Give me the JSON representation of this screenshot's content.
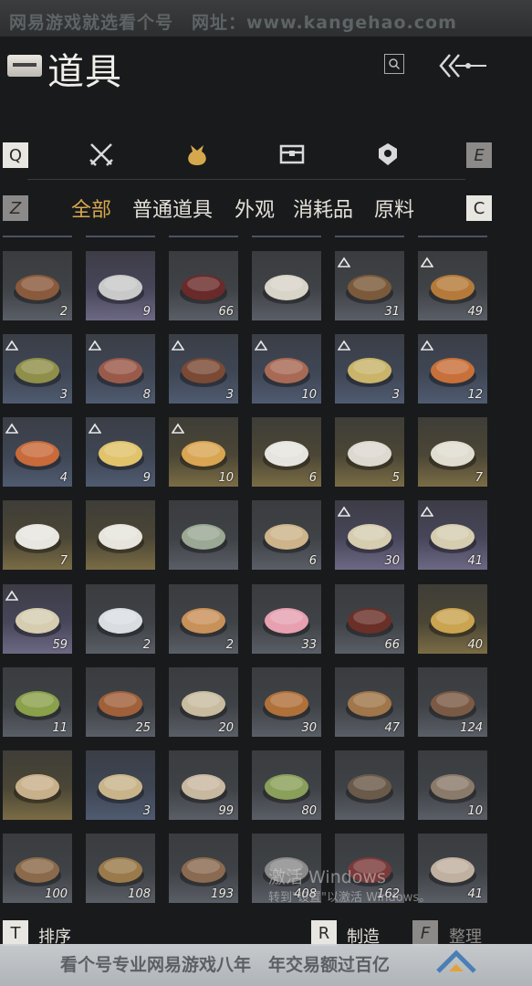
{
  "watermark_top": "网易游戏就选看个号　网址：www.kangehao.com",
  "header": {
    "title": "道具"
  },
  "tabs": {
    "prev_key": "Q",
    "next_key": "E",
    "icons": [
      "weapon-icon",
      "pouch-icon",
      "chest-icon",
      "badge-icon"
    ],
    "active_index": 1
  },
  "subtabs": {
    "prev_key": "Z",
    "next_key": "C",
    "items": [
      "全部",
      "普通道具",
      "外观",
      "消耗品",
      "原料"
    ],
    "active_index": 0
  },
  "items": [
    {
      "name": "stew-bowl",
      "count": "2",
      "tier": "grey",
      "mark": false
    },
    {
      "name": "mountain-emblem",
      "count": "9",
      "tier": "purple",
      "mark": false
    },
    {
      "name": "red-scroll-card",
      "count": "66",
      "tier": "grey",
      "mark": false
    },
    {
      "name": "dumplings",
      "count": "",
      "tier": "grey",
      "mark": false
    },
    {
      "name": "meat-pot",
      "count": "31",
      "tier": "grey",
      "mark": true
    },
    {
      "name": "fried-buns",
      "count": "49",
      "tier": "grey",
      "mark": true
    },
    {
      "name": "herb-dish",
      "count": "3",
      "tier": "blue",
      "mark": true
    },
    {
      "name": "flower-salad",
      "count": "8",
      "tier": "blue",
      "mark": true
    },
    {
      "name": "clay-soup",
      "count": "3",
      "tier": "blue",
      "mark": true
    },
    {
      "name": "braised-pork",
      "count": "10",
      "tier": "blue",
      "mark": true
    },
    {
      "name": "custard-bowl",
      "count": "3",
      "tier": "blue",
      "mark": true
    },
    {
      "name": "meatballs",
      "count": "12",
      "tier": "blue",
      "mark": true
    },
    {
      "name": "fried-chicken",
      "count": "4",
      "tier": "blue",
      "mark": true
    },
    {
      "name": "tofu-cubes",
      "count": "9",
      "tier": "blue",
      "mark": true
    },
    {
      "name": "pastry-stack",
      "count": "10",
      "tier": "gold",
      "mark": true
    },
    {
      "name": "white-bowl",
      "count": "6",
      "tier": "gold",
      "mark": false
    },
    {
      "name": "floral-bowl",
      "count": "5",
      "tier": "gold",
      "mark": false
    },
    {
      "name": "painted-bowl",
      "count": "7",
      "tier": "gold",
      "mark": false
    },
    {
      "name": "rooster-bowl",
      "count": "7",
      "tier": "gold",
      "mark": false
    },
    {
      "name": "covered-dish",
      "count": "",
      "tier": "gold",
      "mark": false
    },
    {
      "name": "celadon-vase",
      "count": "",
      "tier": "grey",
      "mark": false
    },
    {
      "name": "paper-sheet",
      "count": "6",
      "tier": "grey",
      "mark": false
    },
    {
      "name": "letter-page",
      "count": "30",
      "tier": "purple",
      "mark": true
    },
    {
      "name": "letter-page-2",
      "count": "41",
      "tier": "purple",
      "mark": true
    },
    {
      "name": "letter-page-3",
      "count": "59",
      "tier": "purple",
      "mark": true
    },
    {
      "name": "paper-lantern",
      "count": "2",
      "tier": "grey",
      "mark": false
    },
    {
      "name": "flatbread",
      "count": "2",
      "tier": "grey",
      "mark": false
    },
    {
      "name": "plum-blossom",
      "count": "33",
      "tier": "grey",
      "mark": false
    },
    {
      "name": "wine-jar",
      "count": "66",
      "tier": "grey",
      "mark": false
    },
    {
      "name": "gold-coin",
      "count": "40",
      "tier": "gold",
      "mark": false
    },
    {
      "name": "green-powder",
      "count": "11",
      "tier": "grey",
      "mark": false
    },
    {
      "name": "worm",
      "count": "25",
      "tier": "grey",
      "mark": false
    },
    {
      "name": "cloth-sack",
      "count": "20",
      "tier": "grey",
      "mark": false
    },
    {
      "name": "seed-pile",
      "count": "30",
      "tier": "grey",
      "mark": false
    },
    {
      "name": "arrows",
      "count": "47",
      "tier": "grey",
      "mark": false
    },
    {
      "name": "spear-arrows",
      "count": "124",
      "tier": "grey",
      "mark": false
    },
    {
      "name": "painting-scroll",
      "count": "",
      "tier": "gold",
      "mark": false
    },
    {
      "name": "blank-scroll",
      "count": "3",
      "tier": "blue",
      "mark": false
    },
    {
      "name": "birch-logs",
      "count": "99",
      "tier": "grey",
      "mark": false
    },
    {
      "name": "bamboo-logs",
      "count": "80",
      "tier": "grey",
      "mark": false
    },
    {
      "name": "dark-logs",
      "count": "",
      "tier": "grey",
      "mark": false
    },
    {
      "name": "grey-logs",
      "count": "10",
      "tier": "grey",
      "mark": false
    },
    {
      "name": "wood-chips",
      "count": "100",
      "tier": "grey",
      "mark": false
    },
    {
      "name": "bark-pile",
      "count": "108",
      "tier": "grey",
      "mark": false
    },
    {
      "name": "twigs",
      "count": "193",
      "tier": "grey",
      "mark": false
    },
    {
      "name": "stone-ore",
      "count": "408",
      "tier": "grey",
      "mark": false
    },
    {
      "name": "feather",
      "count": "162",
      "tier": "grey",
      "mark": false
    },
    {
      "name": "fungus",
      "count": "41",
      "tier": "grey",
      "mark": false
    }
  ],
  "windows_watermark": {
    "line1": "激活 Windows",
    "line2": "转到\"设置\"以激活 Windows。"
  },
  "bottom": {
    "sort_key": "T",
    "sort_label": "排序",
    "craft_key": "R",
    "craft_label": "制造",
    "tidy_key": "F",
    "tidy_label": "整理"
  },
  "watermark_bottom": "看个号专业网易游戏八年　年交易额过百亿",
  "colors": {
    "accent": "#d6a84e",
    "background": "#191a1c"
  }
}
